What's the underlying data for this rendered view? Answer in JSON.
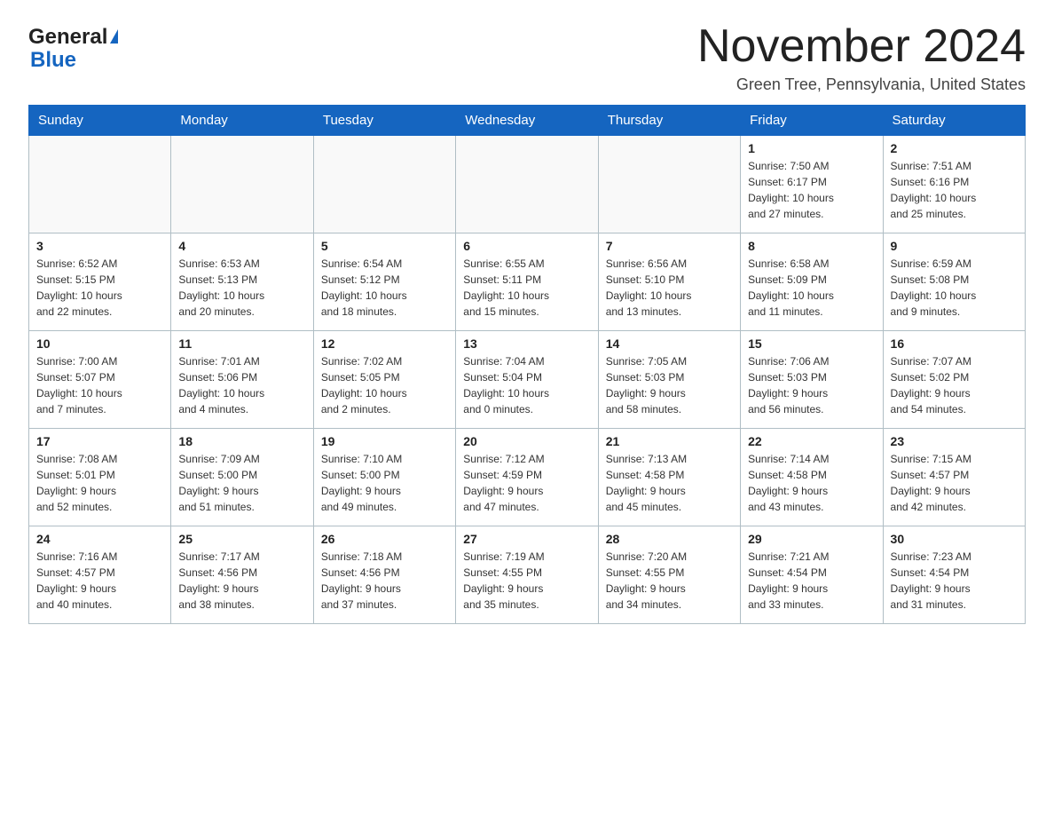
{
  "logo": {
    "general": "General",
    "blue": "Blue"
  },
  "header": {
    "month_year": "November 2024",
    "location": "Green Tree, Pennsylvania, United States"
  },
  "weekdays": [
    "Sunday",
    "Monday",
    "Tuesday",
    "Wednesday",
    "Thursday",
    "Friday",
    "Saturday"
  ],
  "weeks": [
    [
      {
        "num": "",
        "info": ""
      },
      {
        "num": "",
        "info": ""
      },
      {
        "num": "",
        "info": ""
      },
      {
        "num": "",
        "info": ""
      },
      {
        "num": "",
        "info": ""
      },
      {
        "num": "1",
        "info": "Sunrise: 7:50 AM\nSunset: 6:17 PM\nDaylight: 10 hours\nand 27 minutes."
      },
      {
        "num": "2",
        "info": "Sunrise: 7:51 AM\nSunset: 6:16 PM\nDaylight: 10 hours\nand 25 minutes."
      }
    ],
    [
      {
        "num": "3",
        "info": "Sunrise: 6:52 AM\nSunset: 5:15 PM\nDaylight: 10 hours\nand 22 minutes."
      },
      {
        "num": "4",
        "info": "Sunrise: 6:53 AM\nSunset: 5:13 PM\nDaylight: 10 hours\nand 20 minutes."
      },
      {
        "num": "5",
        "info": "Sunrise: 6:54 AM\nSunset: 5:12 PM\nDaylight: 10 hours\nand 18 minutes."
      },
      {
        "num": "6",
        "info": "Sunrise: 6:55 AM\nSunset: 5:11 PM\nDaylight: 10 hours\nand 15 minutes."
      },
      {
        "num": "7",
        "info": "Sunrise: 6:56 AM\nSunset: 5:10 PM\nDaylight: 10 hours\nand 13 minutes."
      },
      {
        "num": "8",
        "info": "Sunrise: 6:58 AM\nSunset: 5:09 PM\nDaylight: 10 hours\nand 11 minutes."
      },
      {
        "num": "9",
        "info": "Sunrise: 6:59 AM\nSunset: 5:08 PM\nDaylight: 10 hours\nand 9 minutes."
      }
    ],
    [
      {
        "num": "10",
        "info": "Sunrise: 7:00 AM\nSunset: 5:07 PM\nDaylight: 10 hours\nand 7 minutes."
      },
      {
        "num": "11",
        "info": "Sunrise: 7:01 AM\nSunset: 5:06 PM\nDaylight: 10 hours\nand 4 minutes."
      },
      {
        "num": "12",
        "info": "Sunrise: 7:02 AM\nSunset: 5:05 PM\nDaylight: 10 hours\nand 2 minutes."
      },
      {
        "num": "13",
        "info": "Sunrise: 7:04 AM\nSunset: 5:04 PM\nDaylight: 10 hours\nand 0 minutes."
      },
      {
        "num": "14",
        "info": "Sunrise: 7:05 AM\nSunset: 5:03 PM\nDaylight: 9 hours\nand 58 minutes."
      },
      {
        "num": "15",
        "info": "Sunrise: 7:06 AM\nSunset: 5:03 PM\nDaylight: 9 hours\nand 56 minutes."
      },
      {
        "num": "16",
        "info": "Sunrise: 7:07 AM\nSunset: 5:02 PM\nDaylight: 9 hours\nand 54 minutes."
      }
    ],
    [
      {
        "num": "17",
        "info": "Sunrise: 7:08 AM\nSunset: 5:01 PM\nDaylight: 9 hours\nand 52 minutes."
      },
      {
        "num": "18",
        "info": "Sunrise: 7:09 AM\nSunset: 5:00 PM\nDaylight: 9 hours\nand 51 minutes."
      },
      {
        "num": "19",
        "info": "Sunrise: 7:10 AM\nSunset: 5:00 PM\nDaylight: 9 hours\nand 49 minutes."
      },
      {
        "num": "20",
        "info": "Sunrise: 7:12 AM\nSunset: 4:59 PM\nDaylight: 9 hours\nand 47 minutes."
      },
      {
        "num": "21",
        "info": "Sunrise: 7:13 AM\nSunset: 4:58 PM\nDaylight: 9 hours\nand 45 minutes."
      },
      {
        "num": "22",
        "info": "Sunrise: 7:14 AM\nSunset: 4:58 PM\nDaylight: 9 hours\nand 43 minutes."
      },
      {
        "num": "23",
        "info": "Sunrise: 7:15 AM\nSunset: 4:57 PM\nDaylight: 9 hours\nand 42 minutes."
      }
    ],
    [
      {
        "num": "24",
        "info": "Sunrise: 7:16 AM\nSunset: 4:57 PM\nDaylight: 9 hours\nand 40 minutes."
      },
      {
        "num": "25",
        "info": "Sunrise: 7:17 AM\nSunset: 4:56 PM\nDaylight: 9 hours\nand 38 minutes."
      },
      {
        "num": "26",
        "info": "Sunrise: 7:18 AM\nSunset: 4:56 PM\nDaylight: 9 hours\nand 37 minutes."
      },
      {
        "num": "27",
        "info": "Sunrise: 7:19 AM\nSunset: 4:55 PM\nDaylight: 9 hours\nand 35 minutes."
      },
      {
        "num": "28",
        "info": "Sunrise: 7:20 AM\nSunset: 4:55 PM\nDaylight: 9 hours\nand 34 minutes."
      },
      {
        "num": "29",
        "info": "Sunrise: 7:21 AM\nSunset: 4:54 PM\nDaylight: 9 hours\nand 33 minutes."
      },
      {
        "num": "30",
        "info": "Sunrise: 7:23 AM\nSunset: 4:54 PM\nDaylight: 9 hours\nand 31 minutes."
      }
    ]
  ]
}
